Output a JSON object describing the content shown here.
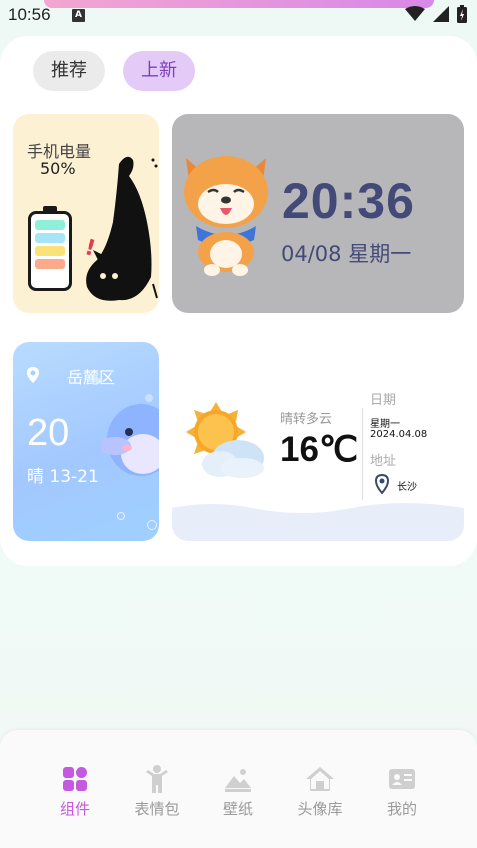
{
  "status": {
    "time": "10:56",
    "notif_badge": "A"
  },
  "tabs": [
    {
      "label": "推荐",
      "active": false
    },
    {
      "label": "上新",
      "active": true
    }
  ],
  "battery_widget": {
    "title": "手机电量",
    "percent": "50%",
    "segment_colors": [
      "#8ef0d8",
      "#a6e5f7",
      "#f9e27a",
      "#fbab8b"
    ]
  },
  "clock_widget": {
    "time": "20:36",
    "date": "04/08 星期一"
  },
  "weather_widget_small": {
    "location": "岳麓区",
    "temp": "20",
    "desc": "晴 13-21"
  },
  "weather_widget_large": {
    "condition": "晴转多云",
    "temp": "16℃",
    "date_label": "日期",
    "weekday": "星期一",
    "date": "2024.04.08",
    "address_label": "地址",
    "city": "长沙"
  },
  "bottom_nav": [
    {
      "label": "组件",
      "icon": "widgets-icon",
      "active": true
    },
    {
      "label": "表情包",
      "icon": "emoji-person-icon",
      "active": false
    },
    {
      "label": "壁纸",
      "icon": "wallpaper-icon",
      "active": false
    },
    {
      "label": "头像库",
      "icon": "home-icon",
      "active": false
    },
    {
      "label": "我的",
      "icon": "profile-card-icon",
      "active": false
    }
  ],
  "colors": {
    "accent": "#c45ae0",
    "tab_active_bg": "#e4cbf7",
    "clock_text": "#434a78"
  }
}
